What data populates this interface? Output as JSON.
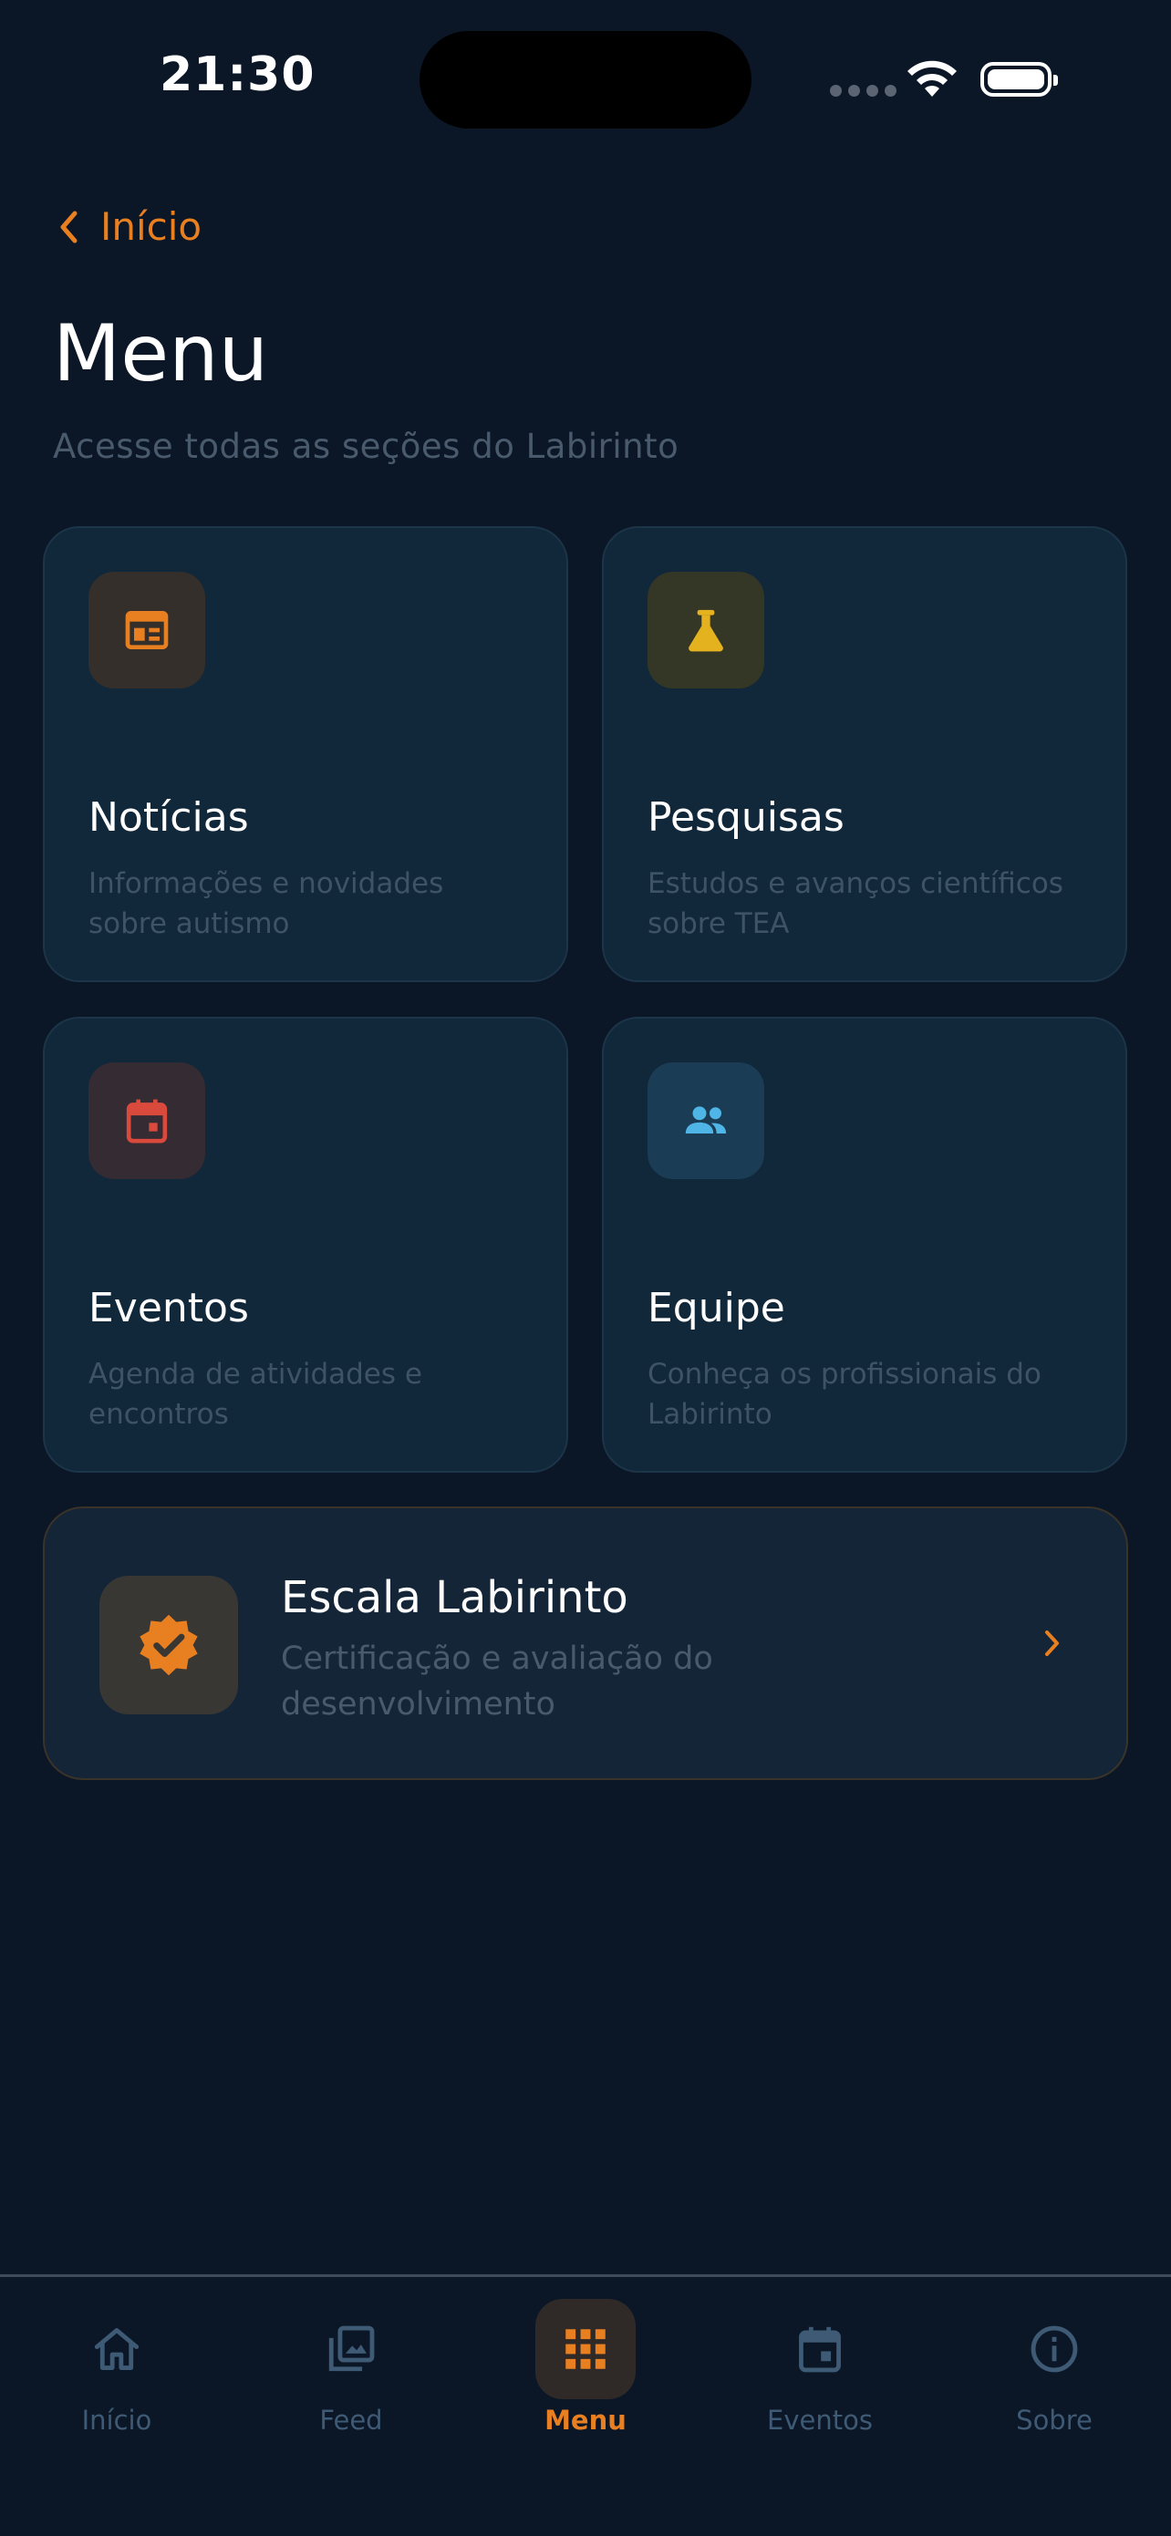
{
  "status_bar": {
    "time": "21:30"
  },
  "nav": {
    "back_label": "Início"
  },
  "header": {
    "title": "Menu",
    "subtitle": "Acesse todas as seções do Labirinto"
  },
  "cards": [
    {
      "title": "Notícias",
      "description": "Informações e novidades sobre autismo",
      "icon": "newspaper-icon",
      "accent": "#e87f20"
    },
    {
      "title": "Pesquisas",
      "description": "Estudos e avanços científicos sobre TEA",
      "icon": "flask-icon",
      "accent": "#e3b21e"
    },
    {
      "title": "Eventos",
      "description": "Agenda de atividades e encontros",
      "icon": "calendar-icon",
      "accent": "#d9493c"
    },
    {
      "title": "Equipe",
      "description": "Conheça os profissionais do Labirinto",
      "icon": "people-icon",
      "accent": "#4fb4e6"
    }
  ],
  "featured": {
    "title": "Escala Labirinto",
    "description": "Certificação e avaliação do desenvolvimento",
    "icon": "verified-badge-icon",
    "accent": "#e87f20"
  },
  "tabbar": {
    "active": "Menu",
    "tabs": [
      {
        "label": "Início",
        "icon": "home-icon"
      },
      {
        "label": "Feed",
        "icon": "gallery-icon"
      },
      {
        "label": "Menu",
        "icon": "grid-icon"
      },
      {
        "label": "Eventos",
        "icon": "calendar-icon"
      },
      {
        "label": "Sobre",
        "icon": "info-icon"
      }
    ]
  },
  "colors": {
    "background": "#0b1727",
    "accent": "#e87f20",
    "card": "#11273a",
    "muted_text": "#3f5366"
  }
}
